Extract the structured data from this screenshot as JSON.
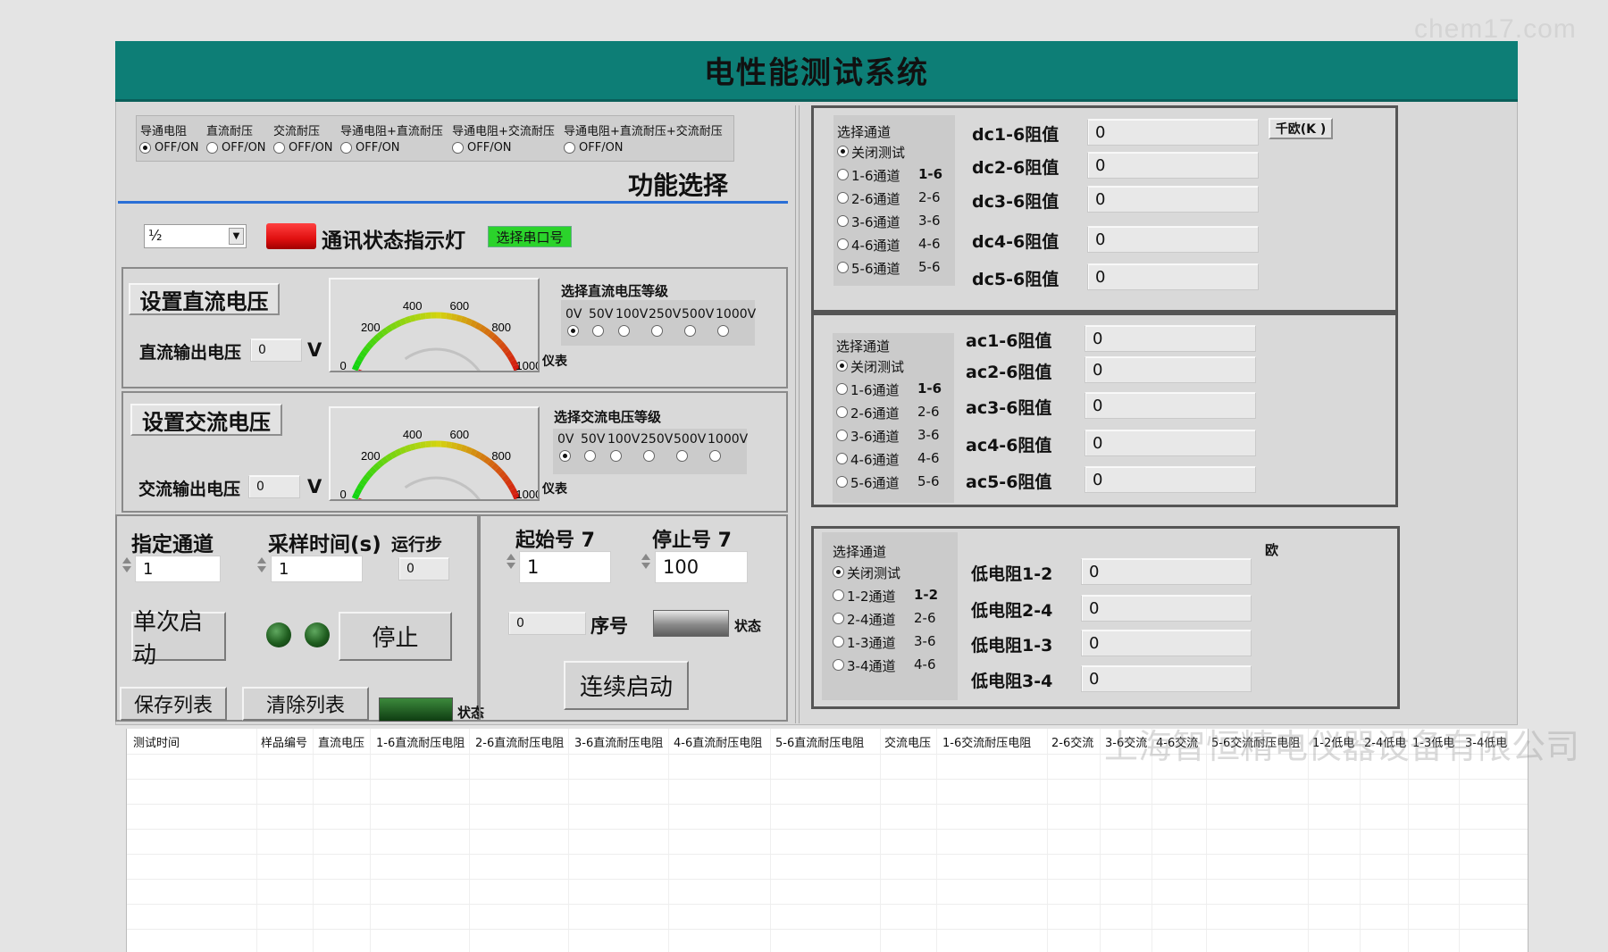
{
  "watermark": {
    "top": "chem17.com",
    "bottom": "上海智恒精电仪器设备有限公司"
  },
  "app": {
    "title": "电性能测试系统"
  },
  "function_select": {
    "options": [
      {
        "label": "导通电阻",
        "state": "OFF/ON",
        "checked": true
      },
      {
        "label": "直流耐压",
        "state": "OFF/ON",
        "checked": false
      },
      {
        "label": "交流耐压",
        "state": "OFF/ON",
        "checked": false
      },
      {
        "label": "导通电阻+直流耐压",
        "state": "OFF/ON",
        "checked": false
      },
      {
        "label": "导通电阻+交流耐压",
        "state": "OFF/ON",
        "checked": false
      },
      {
        "label": "导通电阻+直流耐压+交流耐压",
        "state": "OFF/ON",
        "checked": false
      }
    ],
    "heading": "功能选择"
  },
  "comm": {
    "port_value": "½",
    "indicator_label": "通讯状态指示灯",
    "indicator_color": "#e01010",
    "select_port_label": "选择串口号",
    "select_port_color": "#2bd32b"
  },
  "dc": {
    "title": "设置直流电压",
    "output_label": "直流输出电压",
    "output_value": "0",
    "unit": "V",
    "gauge_ticks": [
      "0",
      "200",
      "400",
      "600",
      "800",
      "1000"
    ],
    "gauge_value": 0,
    "gauge_max": 1000,
    "gauge_label": "仪表",
    "level_title": "选择直流电压等级",
    "levels": [
      "0V",
      "50V",
      "100V",
      "250V",
      "500V",
      "1000V"
    ],
    "selected_level": 0
  },
  "ac": {
    "title": "设置交流电压",
    "output_label": "交流输出电压",
    "output_value": "0",
    "unit": "V",
    "gauge_ticks": [
      "0",
      "200",
      "400",
      "600",
      "800",
      "1000"
    ],
    "gauge_value": 0,
    "gauge_max": 1000,
    "gauge_label": "仪表",
    "level_title": "选择交流电压等级",
    "levels": [
      "0V",
      "50V",
      "100V",
      "250V",
      "500V",
      "1000V"
    ],
    "selected_level": 0
  },
  "control": {
    "channel_label": "指定通道",
    "channel_value": "1",
    "sample_label": "采样时间(s)",
    "sample_value": "1",
    "step_label": "运行步",
    "step_value": "0",
    "single_start": "单次启动",
    "stop": "停止",
    "save_list": "保存列表",
    "clear_list": "清除列表",
    "status_label": "状态"
  },
  "continuous": {
    "start_label": "起始号 7",
    "start_value": "1",
    "stop_label": "停止号 7",
    "stop_value": "100",
    "seq_value": "0",
    "seq_label": "序号",
    "status_label": "状态",
    "start_button": "连续启动"
  },
  "dc_panel": {
    "select_title": "选择通道",
    "channels": [
      {
        "label": "关闭测试",
        "code": "",
        "checked": true
      },
      {
        "label": "1-6通道",
        "code": "1-6",
        "checked": false
      },
      {
        "label": "2-6通道",
        "code": "2-6",
        "checked": false
      },
      {
        "label": "3-6通道",
        "code": "3-6",
        "checked": false
      },
      {
        "label": "4-6通道",
        "code": "4-6",
        "checked": false
      },
      {
        "label": "5-6通道",
        "code": "5-6",
        "checked": false
      }
    ],
    "values": [
      {
        "label": "dc1-6阻值",
        "value": "0"
      },
      {
        "label": "dc2-6阻值",
        "value": "0"
      },
      {
        "label": "dc3-6阻值",
        "value": "0"
      },
      {
        "label": "dc4-6阻值",
        "value": "0"
      },
      {
        "label": "dc5-6阻值",
        "value": "0"
      }
    ],
    "unit": "千欧(K )"
  },
  "ac_panel": {
    "select_title": "选择通道",
    "channels": [
      {
        "label": "关闭测试",
        "code": "",
        "checked": true
      },
      {
        "label": "1-6通道",
        "code": "1-6",
        "checked": false
      },
      {
        "label": "2-6通道",
        "code": "2-6",
        "checked": false
      },
      {
        "label": "3-6通道",
        "code": "3-6",
        "checked": false
      },
      {
        "label": "4-6通道",
        "code": "4-6",
        "checked": false
      },
      {
        "label": "5-6通道",
        "code": "5-6",
        "checked": false
      }
    ],
    "values": [
      {
        "label": "ac1-6阻值",
        "value": "0"
      },
      {
        "label": "ac2-6阻值",
        "value": "0"
      },
      {
        "label": "ac3-6阻值",
        "value": "0"
      },
      {
        "label": "ac4-6阻值",
        "value": "0"
      },
      {
        "label": "ac5-6阻值",
        "value": "0"
      }
    ]
  },
  "low_panel": {
    "select_title": "选择通道",
    "channels": [
      {
        "label": "关闭测试",
        "code": "",
        "checked": true
      },
      {
        "label": "1-2通道",
        "code": "1-2",
        "checked": false
      },
      {
        "label": "2-4通道",
        "code": "2-6",
        "checked": false
      },
      {
        "label": "1-3通道",
        "code": "3-6",
        "checked": false
      },
      {
        "label": "3-4通道",
        "code": "4-6",
        "checked": false
      }
    ],
    "values": [
      {
        "label": "低电阻1-2",
        "value": "0"
      },
      {
        "label": "低电阻2-4",
        "value": "0"
      },
      {
        "label": "低电阻1-3",
        "value": "0"
      },
      {
        "label": "低电阻3-4",
        "value": "0"
      }
    ],
    "unit": "欧"
  },
  "table": {
    "columns": [
      "测试时间",
      "样品编号",
      "直流电压",
      "1-6直流耐压电阻",
      "2-6直流耐压电阻",
      "3-6直流耐压电阻",
      "4-6直流耐压电阻",
      "5-6直流耐压电阻",
      "交流电压",
      "1-6交流耐压电阻",
      "2-6交流",
      "3-6交流",
      "4-6交流",
      "5-6交流耐压电阻",
      "1-2低电",
      "2-4低电",
      "1-3低电",
      "3-4低电"
    ]
  }
}
